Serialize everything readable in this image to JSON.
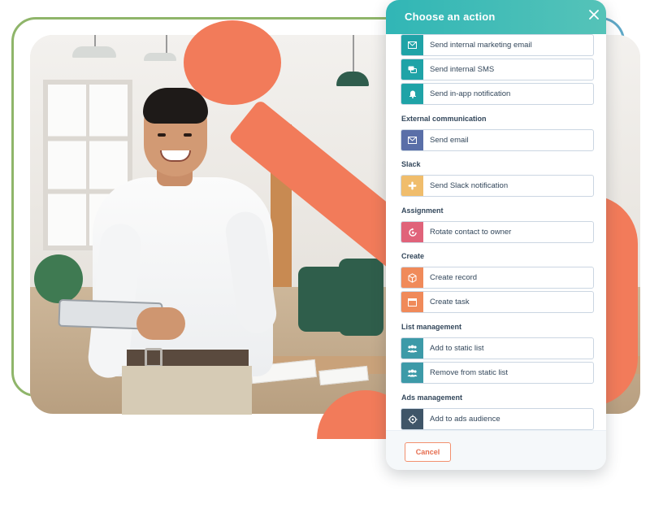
{
  "dialog": {
    "title": "Choose an action",
    "close_icon": "close-icon",
    "cancel_label": "Cancel"
  },
  "sections": [
    {
      "label": "",
      "actions": [
        {
          "label": "Send internal marketing email",
          "icon": "email-icon",
          "color": "#1fa3a7"
        },
        {
          "label": "Send internal SMS",
          "icon": "sms-icon",
          "color": "#1fa3a7"
        },
        {
          "label": "Send in-app notification",
          "icon": "bell-icon",
          "color": "#1fa3a7"
        }
      ]
    },
    {
      "label": "External communication",
      "actions": [
        {
          "label": "Send email",
          "icon": "email-icon",
          "color": "#5a6fa8"
        }
      ]
    },
    {
      "label": "Slack",
      "actions": [
        {
          "label": "Send Slack notification",
          "icon": "slack-icon",
          "color": "#f0bd6c"
        }
      ]
    },
    {
      "label": "Assignment",
      "actions": [
        {
          "label": "Rotate contact to owner",
          "icon": "rotate-user-icon",
          "color": "#e0637a"
        }
      ]
    },
    {
      "label": "Create",
      "actions": [
        {
          "label": "Create record",
          "icon": "cube-icon",
          "color": "#f08a5a"
        },
        {
          "label": "Create task",
          "icon": "task-icon",
          "color": "#f08a5a"
        }
      ]
    },
    {
      "label": "List management",
      "actions": [
        {
          "label": "Add to static list",
          "icon": "people-icon",
          "color": "#3d9aa8"
        },
        {
          "label": "Remove from static list",
          "icon": "people-icon",
          "color": "#3d9aa8"
        }
      ]
    },
    {
      "label": "Ads management",
      "actions": [
        {
          "label": "Add to ads audience",
          "icon": "target-icon",
          "color": "#3f5568"
        }
      ]
    }
  ],
  "colors": {
    "header": "#31b6b6",
    "brand_orange": "#f27b5a",
    "green_frame": "#8fb56a",
    "teal_frame": "#5fa8c7",
    "text": "#33475b"
  }
}
